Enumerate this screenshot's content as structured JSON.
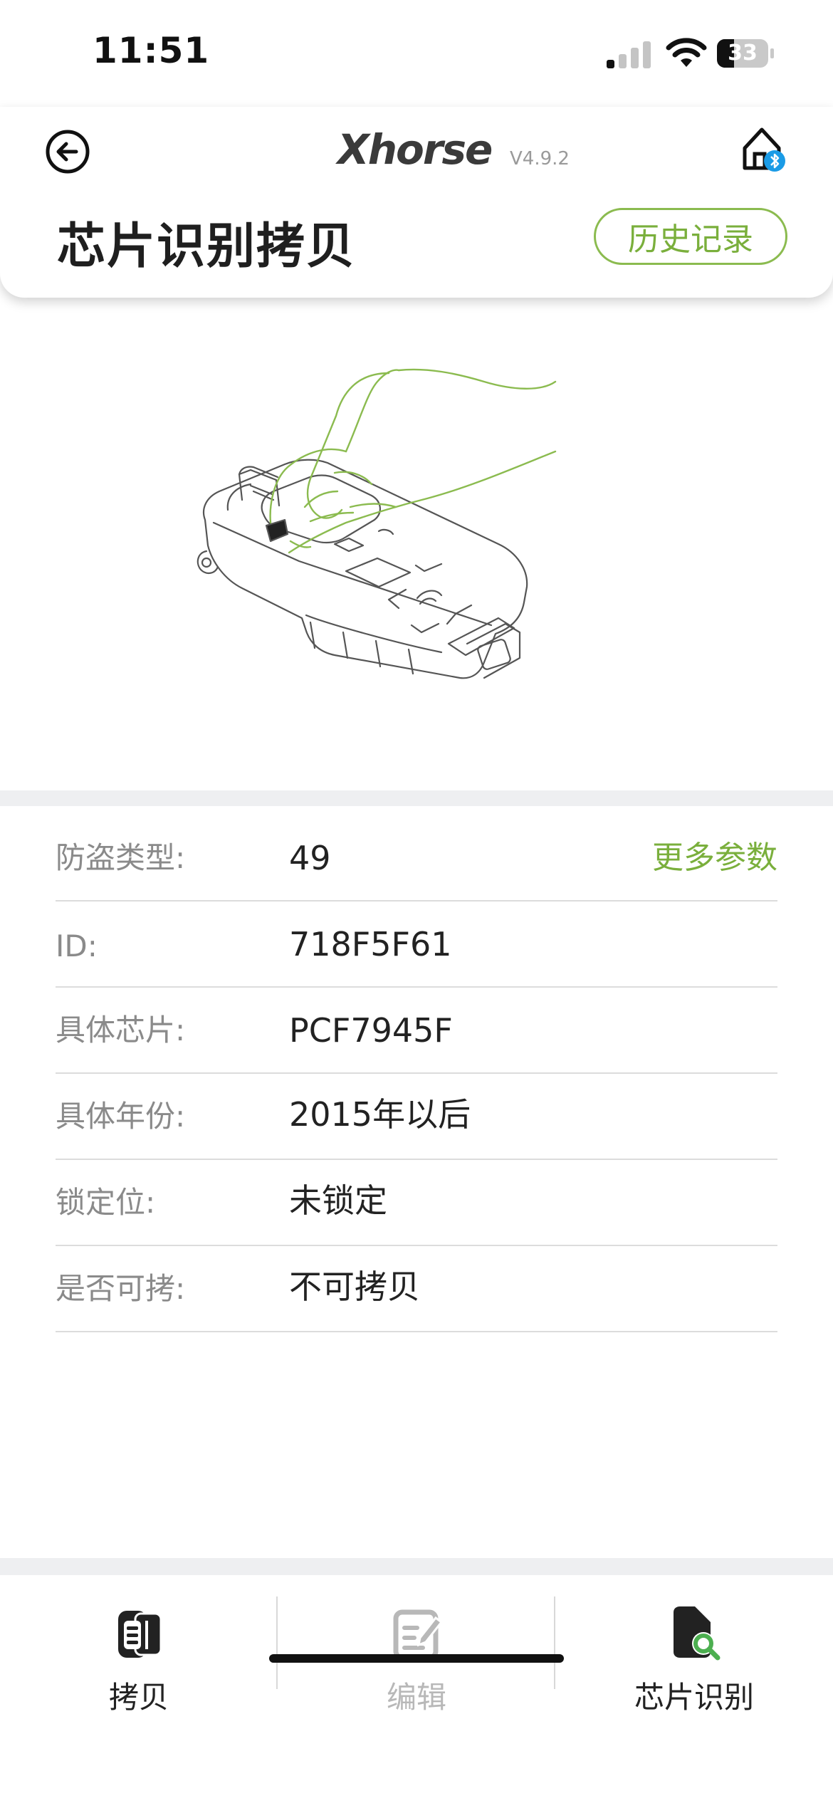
{
  "status_bar": {
    "time": "11:51",
    "battery": "33"
  },
  "header": {
    "brand": "Xhorse",
    "version": "V4.9.2",
    "title": "芯片识别拷贝",
    "history_label": "历史记录"
  },
  "info": {
    "more_params_label": "更多参数",
    "rows": [
      {
        "label": "防盗类型:",
        "value": "49"
      },
      {
        "label": "ID:",
        "value": "718F5F61"
      },
      {
        "label": "具体芯片:",
        "value": "PCF7945F"
      },
      {
        "label": "具体年份:",
        "value": "2015年以后"
      },
      {
        "label": "锁定位:",
        "value": "未锁定"
      },
      {
        "label": "是否可拷:",
        "value": "不可拷贝"
      }
    ]
  },
  "tabs": [
    {
      "label": "拷贝",
      "icon": "key-copy-icon"
    },
    {
      "label": "编辑",
      "icon": "edit-icon"
    },
    {
      "label": "芯片识别",
      "icon": "chip-identify-icon"
    }
  ],
  "colors": {
    "accent": "#7aaf3c",
    "bluetooth": "#1a9be6",
    "disabled": "#b8b8b8"
  }
}
